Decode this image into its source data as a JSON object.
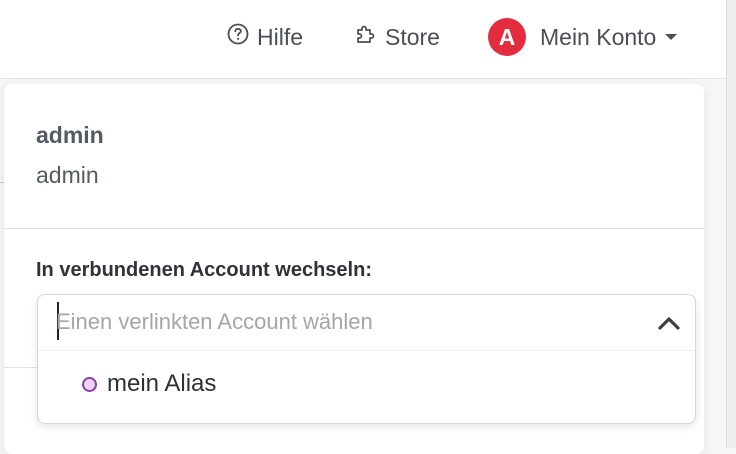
{
  "nav": {
    "help_label": "Hilfe",
    "store_label": "Store",
    "account_label": "Mein Konto",
    "avatar_letter": "A",
    "avatar_color": "#e32d3e"
  },
  "account_menu": {
    "user_name": "admin",
    "user_login": "admin",
    "switch_label": "In verbundenen Account wechseln:",
    "select": {
      "placeholder": "Einen verlinkten Account wählen",
      "value": "",
      "options": [
        {
          "label": "mein Alias",
          "dot_color": "#eed4f0",
          "dot_border": "#8b3fa3"
        }
      ]
    }
  }
}
